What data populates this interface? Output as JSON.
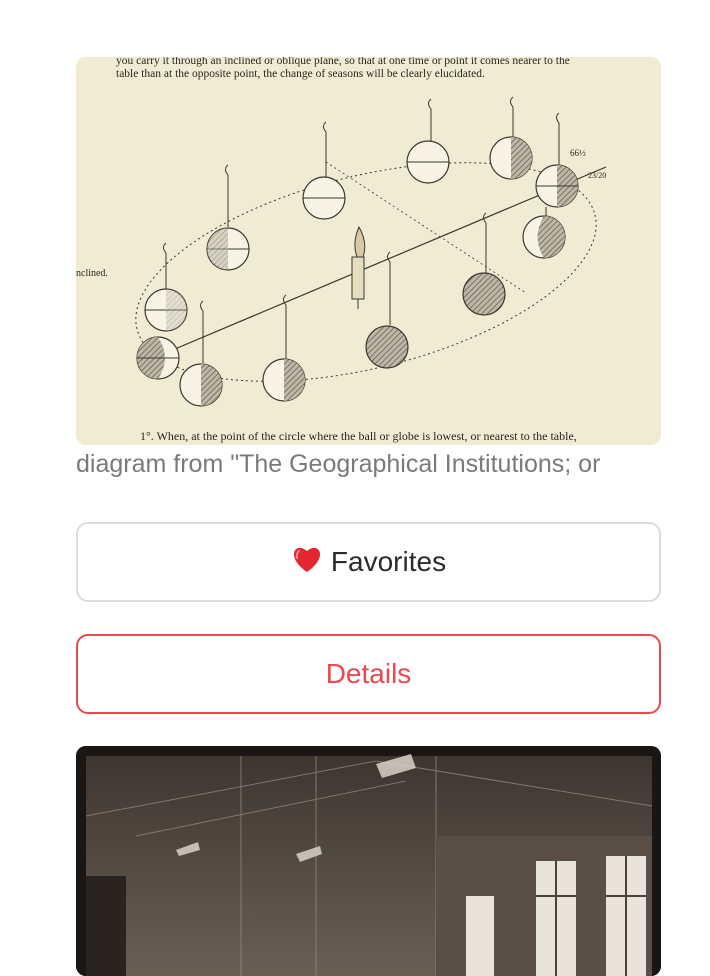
{
  "item1": {
    "scan_text_top_1": "you carry it through an inclined or oblique plane, so that at one time or point it comes nearer to the",
    "scan_text_top_2": "table than at the opposite point, the change of seasons will be clearly elucidated.",
    "scan_text_side": "nclined.",
    "scan_text_bottom": "1°. When, at the point of the circle where the ball or globe is lowest, or nearest to the table,",
    "scan_label_a": "66½",
    "scan_label_b": "23/20",
    "caption": "diagram from \"The Geographical Institutions; or"
  },
  "buttons": {
    "favorites_label": "Favorites",
    "details_label": "Details"
  },
  "colors": {
    "accent": "#e8494f",
    "caption": "#7a7a7a",
    "border": "#dcdcdc"
  }
}
